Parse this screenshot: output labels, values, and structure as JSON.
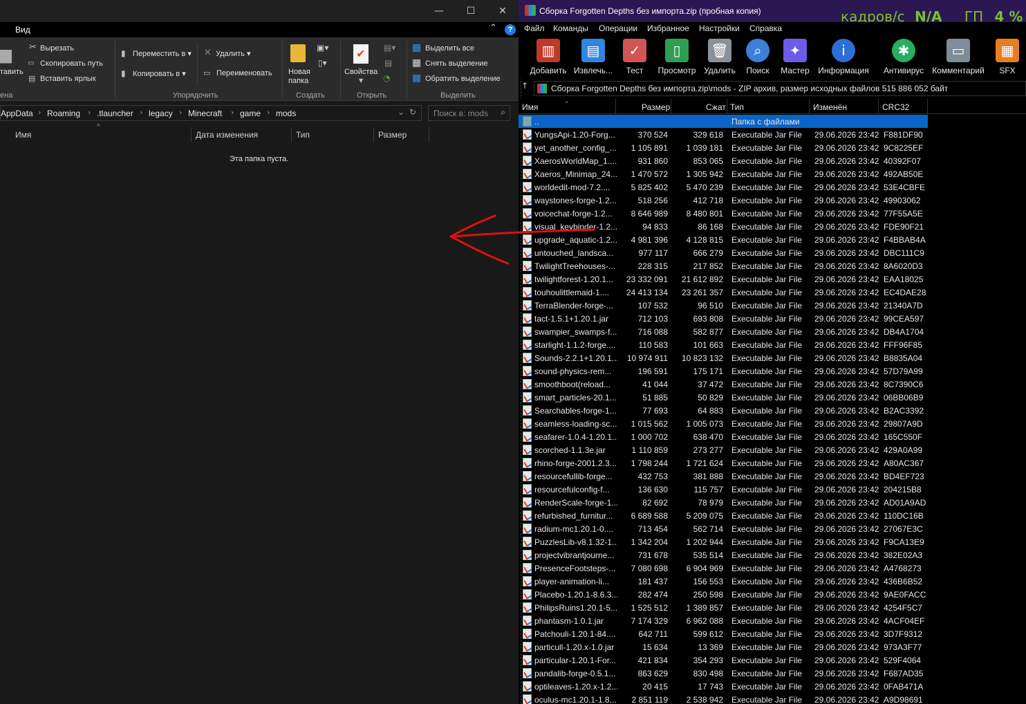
{
  "explorer": {
    "menu": {
      "view_tab": "Вид"
    },
    "ribbon": {
      "paste_partial": "тавить",
      "cut": "Вырезать",
      "copy_path": "Скопировать путь",
      "paste_shortcut": "Вставить ярлык",
      "clipboard_partial": "ена",
      "move_to": "Переместить в",
      "copy_to": "Копировать в",
      "delete": "Удалить",
      "rename": "Переименовать",
      "organize_group": "Упорядочить",
      "new_folder_line1": "Новая",
      "new_folder_line2": "папка",
      "create_group": "Создать",
      "properties": "Свойства",
      "open_group": "Открыть",
      "select_all": "Выделить все",
      "select_none": "Снять выделение",
      "invert_selection": "Обратить выделение",
      "select_group": "Выделить"
    },
    "breadcrumb": [
      "AppData",
      "Roaming",
      ".tlauncher",
      "legacy",
      "Minecraft",
      "game",
      "mods"
    ],
    "search_placeholder": "Поиск в: mods",
    "columns": {
      "name": "Имя",
      "date": "Дата изменения",
      "type": "Тип",
      "size": "Размер"
    },
    "empty_message": "Эта папка пуста."
  },
  "winrar": {
    "title": "Сборка Forgotten Depths без  импорта.zip (пробная копия)",
    "overlay": {
      "fps_label": "кадров/с",
      "fps_value": "N/A",
      "gpu_label": "ГП",
      "gpu_value": "4 %"
    },
    "menu": [
      "Файл",
      "Команды",
      "Операции",
      "Избранное",
      "Настройки",
      "Справка"
    ],
    "toolbar": [
      {
        "label": "Добавить",
        "icon": "add-books-icon",
        "color": "#c0392b"
      },
      {
        "label": "Извлечь...",
        "icon": "extract-folder-icon",
        "color": "#2e86de"
      },
      {
        "label": "Тест",
        "icon": "test-checklist-icon",
        "color": "#d35454"
      },
      {
        "label": "Просмотр",
        "icon": "view-book-icon",
        "color": "#2e9e52"
      },
      {
        "label": "Удалить",
        "icon": "trash-icon",
        "color": "#8a9299"
      },
      {
        "label": "Поиск",
        "icon": "magnifier-icon",
        "color": "#3d7fd6"
      },
      {
        "label": "Мастер",
        "icon": "wizard-wand-icon",
        "color": "#6c5ce7"
      },
      {
        "label": "Информация",
        "icon": "info-icon",
        "color": "#2e6fd6"
      },
      {
        "label": "Антивирус",
        "icon": "antivirus-bug-icon",
        "color": "#27ae60"
      },
      {
        "label": "Комментарий",
        "icon": "comment-icon",
        "color": "#7f8c9a"
      },
      {
        "label": "SFX",
        "icon": "sfx-box-icon",
        "color": "#e67e22"
      }
    ],
    "path": "Сборка Forgotten Depths без  импорта.zip\\mods - ZIP архив, размер исходных файлов 515 886 052 байт",
    "columns": {
      "name": "Имя",
      "size": "Размер",
      "packed": "Сжат",
      "type": "Тип",
      "modified": "Изменён",
      "crc": "CRC32"
    },
    "parent_row": {
      "name": "..",
      "type": "Папка с файлами"
    },
    "files": [
      [
        "YungsApi-1.20-Forg...",
        "370 524",
        "329 618",
        "Executable Jar File",
        "29.06.2026 23:42",
        "F881DF90"
      ],
      [
        "yet_another_config_...",
        "1 105 891",
        "1 039 181",
        "Executable Jar File",
        "29.06.2026 23:42",
        "9C8225EF"
      ],
      [
        "XaerosWorldMap_1....",
        "931 860",
        "853 065",
        "Executable Jar File",
        "29.06.2026 23:42",
        "40392F07"
      ],
      [
        "Xaeros_Minimap_24....",
        "1 470 572",
        "1 305 942",
        "Executable Jar File",
        "29.06.2026 23:42",
        "492AB50E"
      ],
      [
        "worldedit-mod-7.2....",
        "5 825 402",
        "5 470 239",
        "Executable Jar File",
        "29.06.2026 23:42",
        "53E4CBFE"
      ],
      [
        "waystones-forge-1.2...",
        "518 256",
        "412 718",
        "Executable Jar File",
        "29.06.2026 23:42",
        "49903062"
      ],
      [
        "voicechat-forge-1.2...",
        "8 646 989",
        "8 480 801",
        "Executable Jar File",
        "29.06.2026 23:42",
        "77F55A5E"
      ],
      [
        "visual_keybinder-1.2...",
        "94 833",
        "86 168",
        "Executable Jar File",
        "29.06.2026 23:42",
        "FDE90F21"
      ],
      [
        "upgrade_aquatic-1.2...",
        "4 981 396",
        "4 128 815",
        "Executable Jar File",
        "29.06.2026 23:42",
        "F4BBAB4A"
      ],
      [
        "untouched_landsca...",
        "977 117",
        "666 279",
        "Executable Jar File",
        "29.06.2026 23:42",
        "DBC111C9"
      ],
      [
        "TwilightTreehouses-...",
        "228 315",
        "217 852",
        "Executable Jar File",
        "29.06.2026 23:42",
        "8A6020D3"
      ],
      [
        "twilightforest-1.20.1...",
        "23 332 091",
        "21 612 892",
        "Executable Jar File",
        "29.06.2026 23:42",
        "EAA18025"
      ],
      [
        "touhoulittlemaid-1....",
        "24 413 134",
        "23 261 357",
        "Executable Jar File",
        "29.06.2026 23:42",
        "EC4DAE28"
      ],
      [
        "TerraBlender-forge-...",
        "107 532",
        "96 510",
        "Executable Jar File",
        "29.06.2026 23:42",
        "21340A7D"
      ],
      [
        "tact-1.5.1+1.20.1.jar",
        "712 103",
        "693 808",
        "Executable Jar File",
        "29.06.2026 23:42",
        "99CEA597"
      ],
      [
        "swampier_swamps-f...",
        "716 088",
        "582 877",
        "Executable Jar File",
        "29.06.2026 23:42",
        "DB4A1704"
      ],
      [
        "starlight-1.1.2-forge....",
        "110 583",
        "101 663",
        "Executable Jar File",
        "29.06.2026 23:42",
        "FFF96F85"
      ],
      [
        "Sounds-2.2.1+1.20.1...",
        "10 974 911",
        "10 823 132",
        "Executable Jar File",
        "29.06.2026 23:42",
        "B8835A04"
      ],
      [
        "sound-physics-rem...",
        "196 591",
        "175 171",
        "Executable Jar File",
        "29.06.2026 23:42",
        "57D79A99"
      ],
      [
        "smoothboot(reload...",
        "41 044",
        "37 472",
        "Executable Jar File",
        "29.06.2026 23:42",
        "8C7390C6"
      ],
      [
        "smart_particles-20.1....",
        "51 885",
        "50 829",
        "Executable Jar File",
        "29.06.2026 23:42",
        "06BB06B9"
      ],
      [
        "Searchables-forge-1...",
        "77 693",
        "64 883",
        "Executable Jar File",
        "29.06.2026 23:42",
        "B2AC3392"
      ],
      [
        "seamless-loading-sc...",
        "1 015 562",
        "1 005 073",
        "Executable Jar File",
        "29.06.2026 23:42",
        "29807A9D"
      ],
      [
        "seafarer-1.0.4-1.20.1...",
        "1 000 702",
        "638 470",
        "Executable Jar File",
        "29.06.2026 23:42",
        "165C550F"
      ],
      [
        "scorched-1.1.3e.jar",
        "1 110 859",
        "273 277",
        "Executable Jar File",
        "29.06.2026 23:42",
        "429A0A99"
      ],
      [
        "rhino-forge-2001.2.3...",
        "1 798 244",
        "1 721 624",
        "Executable Jar File",
        "29.06.2026 23:42",
        "A80AC367"
      ],
      [
        "resourcefullib-forge...",
        "432 753",
        "381 888",
        "Executable Jar File",
        "29.06.2026 23:42",
        "BD4EF723"
      ],
      [
        "resourcefulconfig-f...",
        "136 630",
        "115 757",
        "Executable Jar File",
        "29.06.2026 23:42",
        "204215B8"
      ],
      [
        "RenderScale-forge-1...",
        "82 692",
        "78 979",
        "Executable Jar File",
        "29.06.2026 23:42",
        "AD01A9AD"
      ],
      [
        "refurbished_furnitur...",
        "6 689 588",
        "5 209 075",
        "Executable Jar File",
        "29.06.2026 23:42",
        "110DC16B"
      ],
      [
        "radium-mc1.20.1-0....",
        "713 454",
        "562 714",
        "Executable Jar File",
        "29.06.2026 23:42",
        "27067E3C"
      ],
      [
        "PuzzlesLib-v8.1.32-1...",
        "1 342 204",
        "1 202 944",
        "Executable Jar File",
        "29.06.2026 23:42",
        "F9CA13E9"
      ],
      [
        "projectvibrantjourne...",
        "731 678",
        "535 514",
        "Executable Jar File",
        "29.06.2026 23:42",
        "382E02A3"
      ],
      [
        "PresenceFootsteps-...",
        "7 080 698",
        "6 904 969",
        "Executable Jar File",
        "29.06.2026 23:42",
        "A4768273"
      ],
      [
        "player-animation-li...",
        "181 437",
        "156 553",
        "Executable Jar File",
        "29.06.2026 23:42",
        "436B6B52"
      ],
      [
        "Placebo-1.20.1-8.6.3...",
        "282 474",
        "250 598",
        "Executable Jar File",
        "29.06.2026 23:42",
        "9AE0FACC"
      ],
      [
        "PhilipsRuins1.20.1-5....",
        "1 525 512",
        "1 389 857",
        "Executable Jar File",
        "29.06.2026 23:42",
        "4254F5C7"
      ],
      [
        "phantasm-1.0.1.jar",
        "7 174 329",
        "6 962 088",
        "Executable Jar File",
        "29.06.2026 23:42",
        "4ACF04EF"
      ],
      [
        "Patchouli-1.20.1-84....",
        "642 711",
        "599 612",
        "Executable Jar File",
        "29.06.2026 23:42",
        "3D7F9312"
      ],
      [
        "particull-1.20.x-1.0.jar",
        "15 634",
        "13 369",
        "Executable Jar File",
        "29.06.2026 23:42",
        "973A3F77"
      ],
      [
        "particular-1.20.1-For...",
        "421 834",
        "354 293",
        "Executable Jar File",
        "29.06.2026 23:42",
        "529F4064"
      ],
      [
        "pandalib-forge-0.5.1...",
        "863 629",
        "830 498",
        "Executable Jar File",
        "29.06.2026 23:42",
        "F687AD35"
      ],
      [
        "optileaves-1.20.x-1.2...",
        "20 415",
        "17 743",
        "Executable Jar File",
        "29.06.2026 23:42",
        "0FAB471A"
      ],
      [
        "oculus-mc1.20.1-1.8...",
        "2 851 119",
        "2 538 942",
        "Executable Jar File",
        "29.06.2026 23:42",
        "A9D98691"
      ]
    ]
  },
  "colors": {
    "explorer_bg": "#191919",
    "ribbon_bg": "#2b2b2b",
    "winrar_title_bg": "#2b1752",
    "selection_blue": "#0a64c8",
    "overlay_green": "#7cbf2f",
    "annotation_red": "#e01010"
  }
}
